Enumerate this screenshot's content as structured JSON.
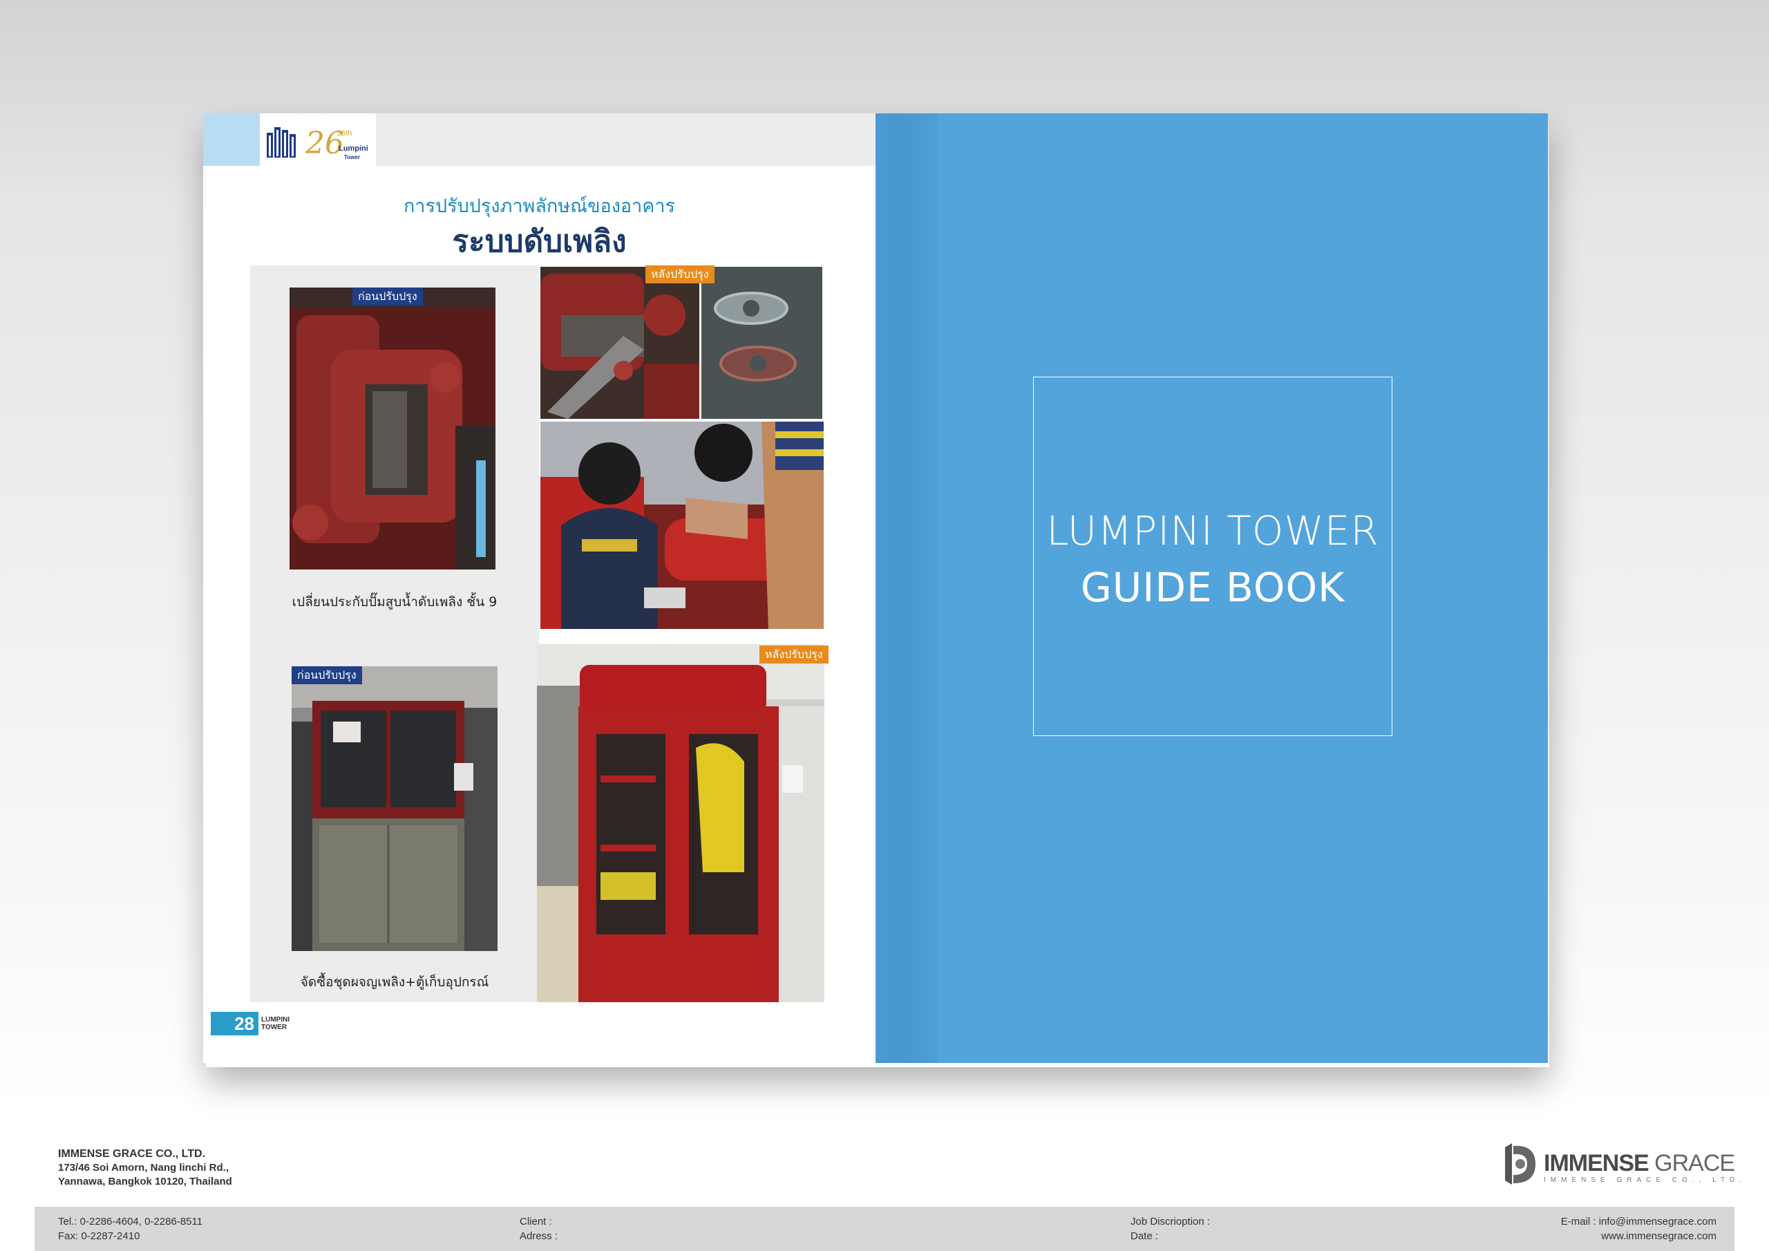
{
  "left_page": {
    "logo": {
      "mark": "26th",
      "brand_line1": "Lumpini",
      "brand_line2": "Tower"
    },
    "subtitle": "การปรับปรุงภาพลักษณ์ของอาคาร",
    "title": "ระบบดับเพลิง",
    "photos": [
      {
        "badge": "ก่อนปรับปรุง",
        "subject": "rusty-pump-gasket"
      },
      {
        "badge": "หลังปรับปรุง",
        "subject": "pump-flange-new-gasket"
      },
      {
        "badge": "",
        "subject": "technicians-repairing-pump"
      },
      {
        "badge": "ก่อนปรับปรุง",
        "subject": "old-cabinet"
      },
      {
        "badge": "หลังปรับปรุง",
        "subject": "new-red-fire-cabinet"
      }
    ],
    "caption_1": "เปลี่ยนประกับปั๊มสูบน้ำดับเพลิง ชั้น 9",
    "caption_2": "จัดซื้อชุดผจญเพลิง+ตู้เก็บอุปกรณ์",
    "page_number": "28",
    "page_brand_line1": "LUMPINI",
    "page_brand_line2": "TOWER"
  },
  "cover": {
    "title_line1": "LUMPINI TOWER",
    "title_line2": "GUIDE BOOK",
    "background_color": "#52a4db"
  },
  "company": {
    "name": "IMMENSE GRACE CO., LTD.",
    "address_line1": "173/46 Soi Amorn, Nang linchi Rd.,",
    "address_line2": "Yannawa, Bangkok 10120, Thailand"
  },
  "brand": {
    "word_left": "IMMENSE",
    "word_right": "GRACE",
    "subline": "IMMENSE GRACE CO., LTD."
  },
  "footer": {
    "tel": "Tel.:  0-2286-4604, 0-2286-8511",
    "fax": "Fax:  0-2287-2410",
    "client_label": "Client  :",
    "adress_label": "Adress :",
    "job_label": "Job Discrioption :",
    "date_label": "Date                :",
    "email": "E-mail :  info@immensegrace.com",
    "website": "www.immensegrace.com"
  }
}
